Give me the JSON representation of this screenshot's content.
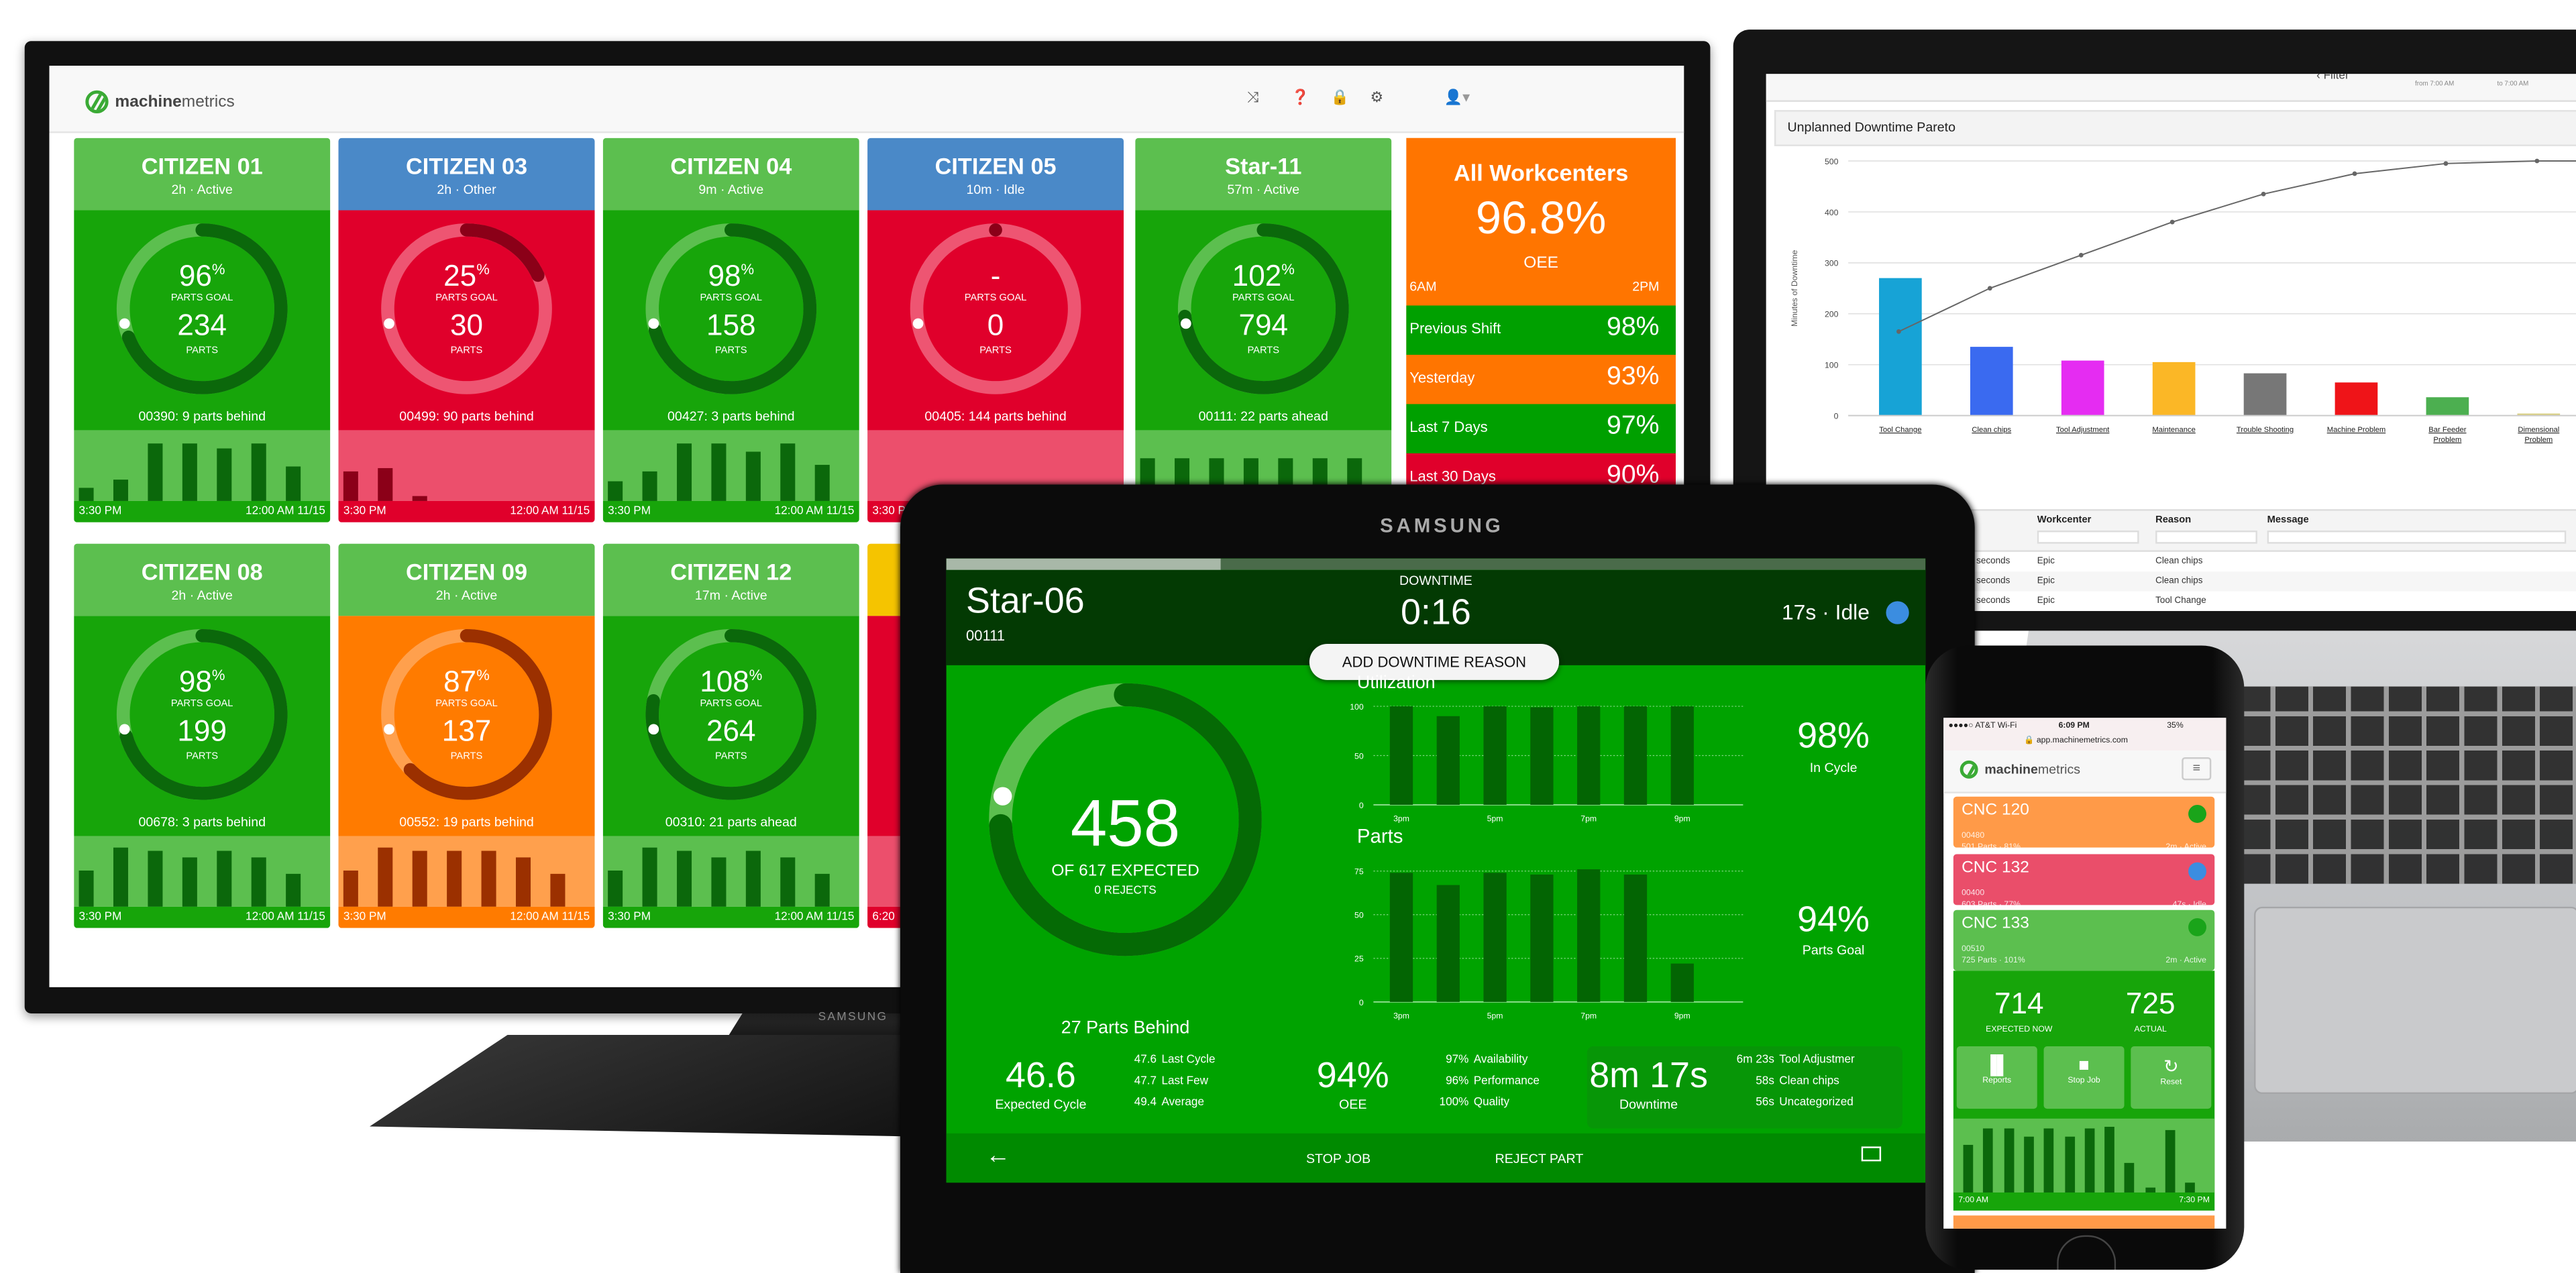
{
  "tv": {
    "brand": "SAMSUNG",
    "logo": {
      "bold": "machine",
      "light": "metrics"
    },
    "header_icons": [
      "shuffle-icon",
      "help-icon",
      "lock-icon",
      "gear-icon",
      "user-icon"
    ],
    "time_start": "3:30 PM",
    "time_end": "12:00 AM 11/15",
    "tiles": [
      {
        "title": "CITIZEN 01",
        "sub": "2h · Active",
        "pct": "96",
        "parts": "234",
        "foot": "00390: 9 parts behind",
        "progress": 0.96,
        "expected_pos": 0.72,
        "head": "#5cbf4f",
        "body": "#17a50a",
        "chart": "#5cbf4f",
        "bar": "#0b680b",
        "track": "#5cbf4f",
        "arc": "#0b680b",
        "bars": [
          0.2,
          0.33,
          0.88,
          0.88,
          0.8,
          0.88,
          0.52
        ]
      },
      {
        "title": "CITIZEN 03",
        "sub": "2h · Other",
        "pct": "25",
        "parts": "30",
        "foot": "00499: 90 parts behind",
        "progress": 0.25,
        "expected_pos": 0.72,
        "head": "#4a89c8",
        "body": "#e0002b",
        "chart": "#ec4f6c",
        "bar": "#8b0018",
        "track": "#ee5572",
        "arc": "#8b0018",
        "bars": [
          0.45,
          0.5,
          0.08
        ]
      },
      {
        "title": "CITIZEN 04",
        "sub": "9m · Active",
        "pct": "98",
        "parts": "158",
        "foot": "00427: 3 parts behind",
        "progress": 0.98,
        "expected_pos": 0.72,
        "head": "#5cbf4f",
        "body": "#17a50a",
        "chart": "#5cbf4f",
        "bar": "#0b680b",
        "track": "#5cbf4f",
        "arc": "#0b680b",
        "bars": [
          0.3,
          0.45,
          0.88,
          0.88,
          0.75,
          0.88,
          0.55
        ]
      },
      {
        "title": "CITIZEN 05",
        "sub": "10m · Idle",
        "pct": "-",
        "parts": "0",
        "foot": "00405: 144 parts behind",
        "progress": 0,
        "expected_pos": 0.72,
        "head": "#4a89c8",
        "body": "#e0002b",
        "chart": "#ec4f6c",
        "bar": "#8b0018",
        "track": "#ee5572",
        "arc": "#8b0018",
        "bars": []
      },
      {
        "title": "Star-11",
        "sub": "57m · Active",
        "pct": "102",
        "parts": "794",
        "foot": "00111: 22 parts ahead",
        "progress": 1.02,
        "expected_pos": 0.72,
        "head": "#5cbf4f",
        "body": "#17a50a",
        "chart": "#5cbf4f",
        "bar": "#0b680b",
        "track": "#5cbf4f",
        "arc": "#0b680b",
        "bars": [
          0.65,
          0.65,
          0.65,
          0.65,
          0.65,
          0.65,
          0.65
        ]
      },
      {
        "title": "CITIZEN 08",
        "sub": "2h · Active",
        "pct": "98",
        "parts": "199",
        "foot": "00678: 3 parts behind",
        "progress": 0.98,
        "expected_pos": 0.72,
        "head": "#5cbf4f",
        "body": "#17a50a",
        "chart": "#5cbf4f",
        "bar": "#0b680b",
        "track": "#5cbf4f",
        "arc": "#0b680b",
        "bars": [
          0.55,
          0.9,
          0.85,
          0.75,
          0.85,
          0.75,
          0.5
        ]
      },
      {
        "title": "CITIZEN 09",
        "sub": "2h · Active",
        "pct": "87",
        "parts": "137",
        "foot": "00552: 19 parts behind",
        "progress": 0.87,
        "expected_pos": 0.72,
        "head": "#5cbf4f",
        "body": "#ff7b00",
        "chart": "#ffa04d",
        "bar": "#9b3000",
        "track": "#ffa04d",
        "arc": "#9b3000",
        "bars": [
          0.55,
          0.9,
          0.85,
          0.85,
          0.85,
          0.75,
          0.5
        ]
      },
      {
        "title": "CITIZEN 12",
        "sub": "17m · Active",
        "pct": "108",
        "parts": "264",
        "foot": "00310: 21 parts ahead",
        "progress": 1.08,
        "expected_pos": 0.72,
        "head": "#5cbf4f",
        "body": "#17a50a",
        "chart": "#5cbf4f",
        "bar": "#0b680b",
        "track": "#5cbf4f",
        "arc": "#0b680b",
        "bars": [
          0.55,
          0.9,
          0.85,
          0.75,
          0.85,
          0.75,
          0.5
        ]
      },
      {
        "title": "",
        "sub": "",
        "pct": "",
        "parts": "",
        "foot": "",
        "progress": 0,
        "expected_pos": 0.72,
        "head": "#f5c400",
        "body": "#e0002b",
        "chart": "#ec4f6c",
        "bar": "#8b0018",
        "track": "#ee5572",
        "arc": "#8b0018",
        "bars": [],
        "time_start": "6:20"
      }
    ],
    "all_workcenters": {
      "title": "All Workcenters",
      "value": "96.8%",
      "label": "OEE",
      "start": "6AM",
      "end": "2PM",
      "rows": [
        {
          "label": "Previous Shift",
          "value": "98%",
          "color": "#00a000"
        },
        {
          "label": "Yesterday",
          "value": "93%",
          "color": "#ff7500"
        },
        {
          "label": "Last 7 Days",
          "value": "97%",
          "color": "#00a000"
        },
        {
          "label": "Last 30 Days",
          "value": "90%",
          "color": "#e0002b"
        }
      ]
    }
  },
  "laptop": {
    "filter": {
      "label": "Filter",
      "from": "from 7:00 AM",
      "to": "to 7:00 AM"
    },
    "chart_data": {
      "type": "bar",
      "title": "Unplanned Downtime Pareto",
      "ylabel": "Minutes of Downtime",
      "ylim": [
        0,
        500
      ],
      "yticks": [
        0,
        100,
        200,
        300,
        400,
        500
      ],
      "grid": true,
      "categories": [
        "Tool Change",
        "Clean chips",
        "Tool Adjustment",
        "Maintenance",
        "Trouble Shooting",
        "Machine Problem",
        "Bar Feeder Problem",
        "Dimensional Problem"
      ],
      "values": [
        270,
        135,
        108,
        105,
        83,
        65,
        36,
        4
      ],
      "colors": [
        "#17a3d6",
        "#3a6af0",
        "#e52cf2",
        "#fbb726",
        "#777777",
        "#ef1418",
        "#4caf50",
        "#d8cf80"
      ],
      "cumulative_line": [
        165,
        250,
        315,
        380,
        435,
        475,
        495,
        500
      ]
    },
    "table": {
      "headers": [
        "Workcenter",
        "Reason",
        "Message"
      ],
      "rows": [
        [
          "seconds",
          "Epic",
          "Clean chips"
        ],
        [
          "seconds",
          "Epic",
          "Clean chips"
        ],
        [
          "seconds",
          "Epic",
          "Tool Change"
        ]
      ]
    }
  },
  "tablet": {
    "brand": "SAMSUNG",
    "machine": "Star-06",
    "job": "00111",
    "downtime_label": "DOWNTIME",
    "downtime_value": "0:16",
    "status": "17s · Idle",
    "status_color": "#3b8de0",
    "add_reason": "ADD DOWNTIME REASON",
    "parts": "458",
    "expected": "OF 617 EXPECTED",
    "rejects": "0 REJECTS",
    "behind": "27 Parts Behind",
    "ring_progress": 0.742,
    "ring_expected": 0.78,
    "utilization": {
      "title": "Utilization",
      "yticks": [
        0,
        50,
        100
      ],
      "ymax": 100,
      "values": [
        100,
        90,
        100,
        99,
        100,
        100,
        100
      ],
      "xlabels": [
        "3pm",
        "5pm",
        "7pm",
        "9pm"
      ],
      "stat": "98%",
      "stat_label": "In Cycle"
    },
    "parts_chart": {
      "title": "Parts",
      "yticks": [
        0,
        25,
        50,
        75
      ],
      "ymax": 80,
      "values": [
        74,
        67,
        74,
        73,
        76,
        73,
        22
      ],
      "xlabels": [
        "3pm",
        "5pm",
        "7pm",
        "9pm"
      ],
      "stat": "94%",
      "stat_label": "Parts Goal"
    },
    "cycle": {
      "value": "46.6",
      "label": "Expected Cycle",
      "rows": [
        [
          "47.6",
          "Last Cycle"
        ],
        [
          "47.7",
          "Last Few"
        ],
        [
          "49.4",
          "Average"
        ]
      ]
    },
    "oee": {
      "value": "94%",
      "label": "OEE",
      "rows": [
        [
          "97%",
          "Availability"
        ],
        [
          "96%",
          "Performance"
        ],
        [
          "100%",
          "Quality"
        ]
      ]
    },
    "downtime": {
      "value": "8m 17s",
      "label": "Downtime",
      "rows": [
        [
          "6m 23s",
          "Tool Adjustmer"
        ],
        [
          "58s",
          "Clean chips"
        ],
        [
          "56s",
          "Uncategorized"
        ]
      ]
    },
    "nav": {
      "stop": "STOP JOB",
      "reject": "REJECT PART"
    }
  },
  "phone": {
    "carrier": "●●●●○ AT&T Wi-Fi",
    "time": "6:09 PM",
    "battery": "35%",
    "url": "app.machinemetrics.com",
    "cards": [
      {
        "name": "CNC 120",
        "job": "00480",
        "parts": "501 Parts · 81%",
        "status": "2m · Active",
        "color": "#ff9a48",
        "dot": "#1aa41a"
      },
      {
        "name": "CNC 132",
        "job": "00400",
        "parts": "603 Parts · 77%",
        "status": "47s · Idle",
        "color": "#ea4e6a",
        "dot": "#3b8de0"
      },
      {
        "name": "CNC 133",
        "job": "00510",
        "parts": "725 Parts · 101%",
        "status": "2m · Active",
        "color": "#5cbf4f",
        "dot": "#1aa41a"
      }
    ],
    "expected": "714",
    "expected_label": "EXPECTED NOW",
    "actual": "725",
    "actual_label": "ACTUAL",
    "buttons": [
      "Reports",
      "Stop Job",
      "Reset"
    ],
    "bars": [
      0.73,
      0.97,
      0.97,
      0.84,
      0.97,
      0.85,
      0.97,
      0.99,
      0.44,
      0.07,
      0.96,
      0.16
    ],
    "time_start": "7:00 AM",
    "time_end": "7:30 PM"
  }
}
